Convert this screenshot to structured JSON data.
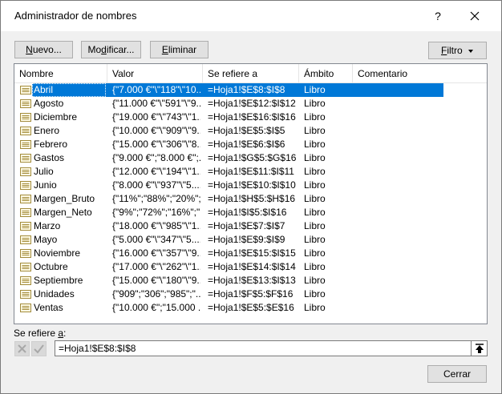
{
  "dialog": {
    "title": "Administrador de nombres",
    "help": "?"
  },
  "toolbar": {
    "nuevo": {
      "pre": "",
      "key": "N",
      "post": "uevo..."
    },
    "modificar": {
      "pre": "Mo",
      "key": "d",
      "post": "ificar..."
    },
    "eliminar": {
      "pre": "",
      "key": "E",
      "post": "liminar"
    },
    "filtro": {
      "pre": "",
      "key": "F",
      "post": "iltro"
    }
  },
  "columns": {
    "nombre": "Nombre",
    "valor": "Valor",
    "refiere": "Se refiere a",
    "ambito": "Ámbito",
    "comentario": "Comentario"
  },
  "rows": [
    {
      "name": "Abril",
      "value": "{\"7.000 €\"\\\"118\"\\\"10...",
      "ref": "=Hoja1!$E$8:$I$8",
      "scope": "Libro",
      "comment": "",
      "selected": true
    },
    {
      "name": "Agosto",
      "value": "{\"11.000 €\"\\\"591\"\\\"9...",
      "ref": "=Hoja1!$E$12:$I$12",
      "scope": "Libro",
      "comment": ""
    },
    {
      "name": "Diciembre",
      "value": "{\"19.000 €\"\\\"743\"\\\"1...",
      "ref": "=Hoja1!$E$16:$I$16",
      "scope": "Libro",
      "comment": ""
    },
    {
      "name": "Enero",
      "value": "{\"10.000 €\"\\\"909\"\\\"9...",
      "ref": "=Hoja1!$E$5:$I$5",
      "scope": "Libro",
      "comment": ""
    },
    {
      "name": "Febrero",
      "value": "{\"15.000 €\"\\\"306\"\\\"8...",
      "ref": "=Hoja1!$E$6:$I$6",
      "scope": "Libro",
      "comment": ""
    },
    {
      "name": "Gastos",
      "value": "{\"9.000 €\";\"8.000 €\";...",
      "ref": "=Hoja1!$G$5:$G$16",
      "scope": "Libro",
      "comment": ""
    },
    {
      "name": "Julio",
      "value": "{\"12.000 €\"\\\"194\"\\\"1...",
      "ref": "=Hoja1!$E$11:$I$11",
      "scope": "Libro",
      "comment": ""
    },
    {
      "name": "Junio",
      "value": "{\"8.000 €\"\\\"937\"\\\"5....",
      "ref": "=Hoja1!$E$10:$I$10",
      "scope": "Libro",
      "comment": ""
    },
    {
      "name": "Margen_Bruto",
      "value": "{\"11%\";\"88%\";\"20%\";...",
      "ref": "=Hoja1!$H$5:$H$16",
      "scope": "Libro",
      "comment": ""
    },
    {
      "name": "Margen_Neto",
      "value": "{\"9%\";\"72%\";\"16%\";\"...",
      "ref": "=Hoja1!$I$5:$I$16",
      "scope": "Libro",
      "comment": ""
    },
    {
      "name": "Marzo",
      "value": "{\"18.000 €\"\\\"985\"\\\"1...",
      "ref": "=Hoja1!$E$7:$I$7",
      "scope": "Libro",
      "comment": ""
    },
    {
      "name": "Mayo",
      "value": "{\"5.000 €\"\\\"347\"\\\"5....",
      "ref": "=Hoja1!$E$9:$I$9",
      "scope": "Libro",
      "comment": ""
    },
    {
      "name": "Noviembre",
      "value": "{\"16.000 €\"\\\"357\"\\\"9...",
      "ref": "=Hoja1!$E$15:$I$15",
      "scope": "Libro",
      "comment": ""
    },
    {
      "name": "Octubre",
      "value": "{\"17.000 €\"\\\"262\"\\\"1...",
      "ref": "=Hoja1!$E$14:$I$14",
      "scope": "Libro",
      "comment": ""
    },
    {
      "name": "Septiembre",
      "value": "{\"15.000 €\"\\\"180\"\\\"9...",
      "ref": "=Hoja1!$E$13:$I$13",
      "scope": "Libro",
      "comment": ""
    },
    {
      "name": "Unidades",
      "value": "{\"909\";\"306\";\"985\";\"...",
      "ref": "=Hoja1!$F$5:$F$16",
      "scope": "Libro",
      "comment": ""
    },
    {
      "name": "Ventas",
      "value": "{\"10.000 €\";\"15.000 ...",
      "ref": "=Hoja1!$E$5:$E$16",
      "scope": "Libro",
      "comment": ""
    }
  ],
  "refers_to": {
    "label_pre": "Se refiere ",
    "label_key": "a",
    "label_post": ":",
    "value": "=Hoja1!$E$8:$I$8"
  },
  "footer": {
    "cerrar": "Cerrar"
  },
  "colors": {
    "selection": "#0078d7"
  },
  "icons": {
    "name_icon": "named-range-icon",
    "collapse": "collapse-dialog-icon",
    "cancel": "cancel-x-icon",
    "confirm": "confirm-check-icon",
    "close": "close-icon",
    "dropdown": "caret-down-icon"
  }
}
